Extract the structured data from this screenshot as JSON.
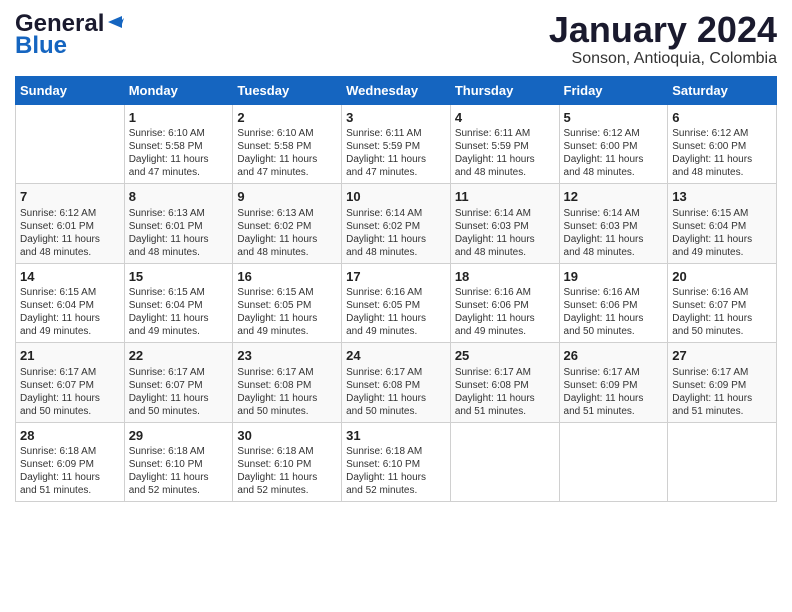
{
  "header": {
    "logo_line1": "General",
    "logo_line2": "Blue",
    "month": "January 2024",
    "location": "Sonson, Antioquia, Colombia"
  },
  "weekdays": [
    "Sunday",
    "Monday",
    "Tuesday",
    "Wednesday",
    "Thursday",
    "Friday",
    "Saturday"
  ],
  "weeks": [
    [
      {
        "day": "",
        "info": ""
      },
      {
        "day": "1",
        "info": "Sunrise: 6:10 AM\nSunset: 5:58 PM\nDaylight: 11 hours\nand 47 minutes."
      },
      {
        "day": "2",
        "info": "Sunrise: 6:10 AM\nSunset: 5:58 PM\nDaylight: 11 hours\nand 47 minutes."
      },
      {
        "day": "3",
        "info": "Sunrise: 6:11 AM\nSunset: 5:59 PM\nDaylight: 11 hours\nand 47 minutes."
      },
      {
        "day": "4",
        "info": "Sunrise: 6:11 AM\nSunset: 5:59 PM\nDaylight: 11 hours\nand 48 minutes."
      },
      {
        "day": "5",
        "info": "Sunrise: 6:12 AM\nSunset: 6:00 PM\nDaylight: 11 hours\nand 48 minutes."
      },
      {
        "day": "6",
        "info": "Sunrise: 6:12 AM\nSunset: 6:00 PM\nDaylight: 11 hours\nand 48 minutes."
      }
    ],
    [
      {
        "day": "7",
        "info": "Sunrise: 6:12 AM\nSunset: 6:01 PM\nDaylight: 11 hours\nand 48 minutes."
      },
      {
        "day": "8",
        "info": "Sunrise: 6:13 AM\nSunset: 6:01 PM\nDaylight: 11 hours\nand 48 minutes."
      },
      {
        "day": "9",
        "info": "Sunrise: 6:13 AM\nSunset: 6:02 PM\nDaylight: 11 hours\nand 48 minutes."
      },
      {
        "day": "10",
        "info": "Sunrise: 6:14 AM\nSunset: 6:02 PM\nDaylight: 11 hours\nand 48 minutes."
      },
      {
        "day": "11",
        "info": "Sunrise: 6:14 AM\nSunset: 6:03 PM\nDaylight: 11 hours\nand 48 minutes."
      },
      {
        "day": "12",
        "info": "Sunrise: 6:14 AM\nSunset: 6:03 PM\nDaylight: 11 hours\nand 48 minutes."
      },
      {
        "day": "13",
        "info": "Sunrise: 6:15 AM\nSunset: 6:04 PM\nDaylight: 11 hours\nand 49 minutes."
      }
    ],
    [
      {
        "day": "14",
        "info": "Sunrise: 6:15 AM\nSunset: 6:04 PM\nDaylight: 11 hours\nand 49 minutes."
      },
      {
        "day": "15",
        "info": "Sunrise: 6:15 AM\nSunset: 6:04 PM\nDaylight: 11 hours\nand 49 minutes."
      },
      {
        "day": "16",
        "info": "Sunrise: 6:15 AM\nSunset: 6:05 PM\nDaylight: 11 hours\nand 49 minutes."
      },
      {
        "day": "17",
        "info": "Sunrise: 6:16 AM\nSunset: 6:05 PM\nDaylight: 11 hours\nand 49 minutes."
      },
      {
        "day": "18",
        "info": "Sunrise: 6:16 AM\nSunset: 6:06 PM\nDaylight: 11 hours\nand 49 minutes."
      },
      {
        "day": "19",
        "info": "Sunrise: 6:16 AM\nSunset: 6:06 PM\nDaylight: 11 hours\nand 50 minutes."
      },
      {
        "day": "20",
        "info": "Sunrise: 6:16 AM\nSunset: 6:07 PM\nDaylight: 11 hours\nand 50 minutes."
      }
    ],
    [
      {
        "day": "21",
        "info": "Sunrise: 6:17 AM\nSunset: 6:07 PM\nDaylight: 11 hours\nand 50 minutes."
      },
      {
        "day": "22",
        "info": "Sunrise: 6:17 AM\nSunset: 6:07 PM\nDaylight: 11 hours\nand 50 minutes."
      },
      {
        "day": "23",
        "info": "Sunrise: 6:17 AM\nSunset: 6:08 PM\nDaylight: 11 hours\nand 50 minutes."
      },
      {
        "day": "24",
        "info": "Sunrise: 6:17 AM\nSunset: 6:08 PM\nDaylight: 11 hours\nand 50 minutes."
      },
      {
        "day": "25",
        "info": "Sunrise: 6:17 AM\nSunset: 6:08 PM\nDaylight: 11 hours\nand 51 minutes."
      },
      {
        "day": "26",
        "info": "Sunrise: 6:17 AM\nSunset: 6:09 PM\nDaylight: 11 hours\nand 51 minutes."
      },
      {
        "day": "27",
        "info": "Sunrise: 6:17 AM\nSunset: 6:09 PM\nDaylight: 11 hours\nand 51 minutes."
      }
    ],
    [
      {
        "day": "28",
        "info": "Sunrise: 6:18 AM\nSunset: 6:09 PM\nDaylight: 11 hours\nand 51 minutes."
      },
      {
        "day": "29",
        "info": "Sunrise: 6:18 AM\nSunset: 6:10 PM\nDaylight: 11 hours\nand 52 minutes."
      },
      {
        "day": "30",
        "info": "Sunrise: 6:18 AM\nSunset: 6:10 PM\nDaylight: 11 hours\nand 52 minutes."
      },
      {
        "day": "31",
        "info": "Sunrise: 6:18 AM\nSunset: 6:10 PM\nDaylight: 11 hours\nand 52 minutes."
      },
      {
        "day": "",
        "info": ""
      },
      {
        "day": "",
        "info": ""
      },
      {
        "day": "",
        "info": ""
      }
    ]
  ]
}
